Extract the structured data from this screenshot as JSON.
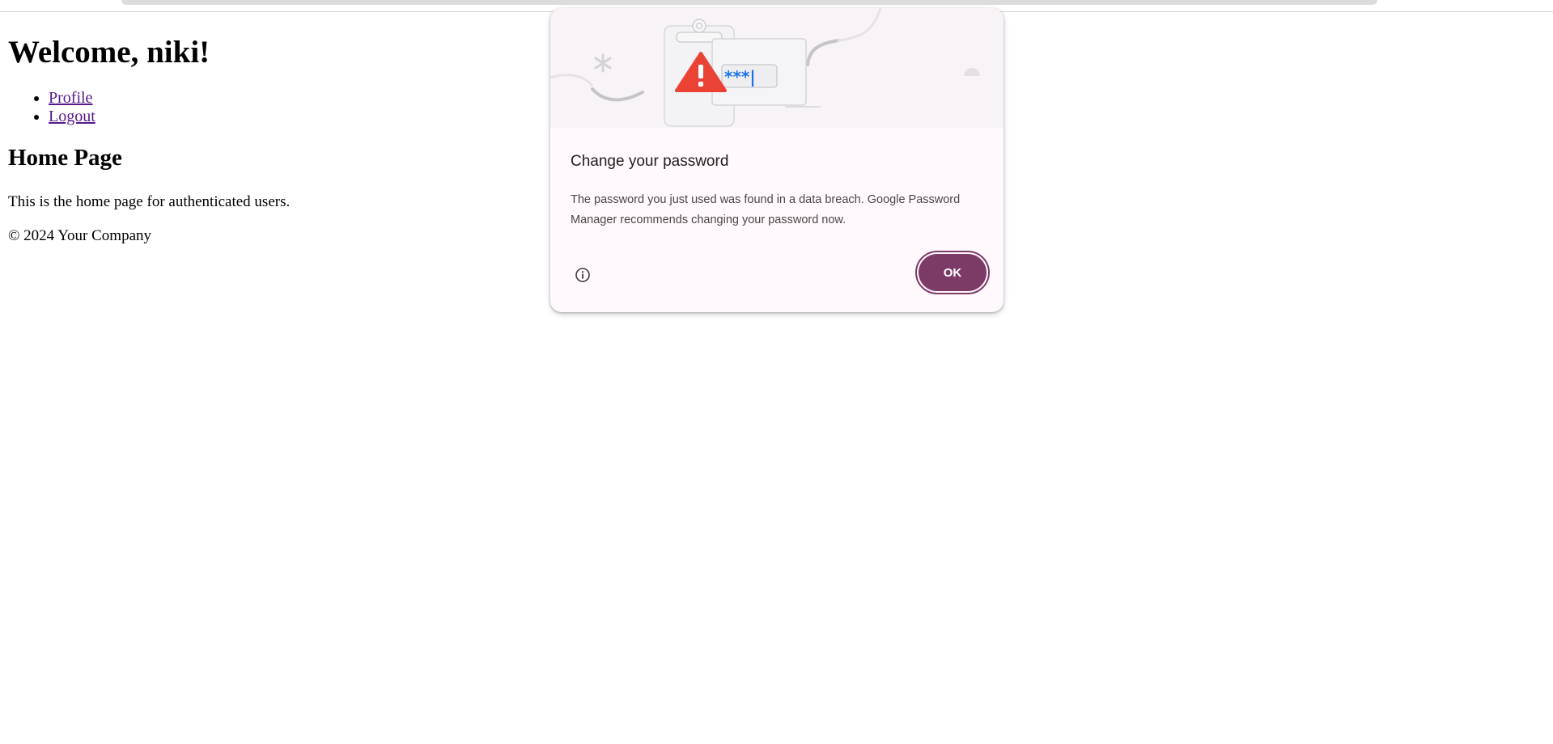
{
  "page": {
    "heading": "Welcome, niki!",
    "nav": [
      {
        "label": "Profile"
      },
      {
        "label": "Logout"
      }
    ],
    "section_title": "Home Page",
    "intro": "This is the home page for authenticated users.",
    "footer": "© 2024 Your Company"
  },
  "dialog": {
    "title": "Change your password",
    "body": "The password you just used was found in a data breach. Google Password Manager recommends changing your password now.",
    "ok_label": "OK",
    "masked_password": "***|",
    "illustration_icons": [
      "clipboard-icon",
      "warning-triangle-icon",
      "password-field-icon",
      "sparkle-icon"
    ],
    "info_icon": "info-circle-icon",
    "colors": {
      "accent": "#7c3b66",
      "warning": "#ea4335",
      "password_dots": "#1a73e8",
      "dialog_background": "#fff8fc"
    }
  }
}
